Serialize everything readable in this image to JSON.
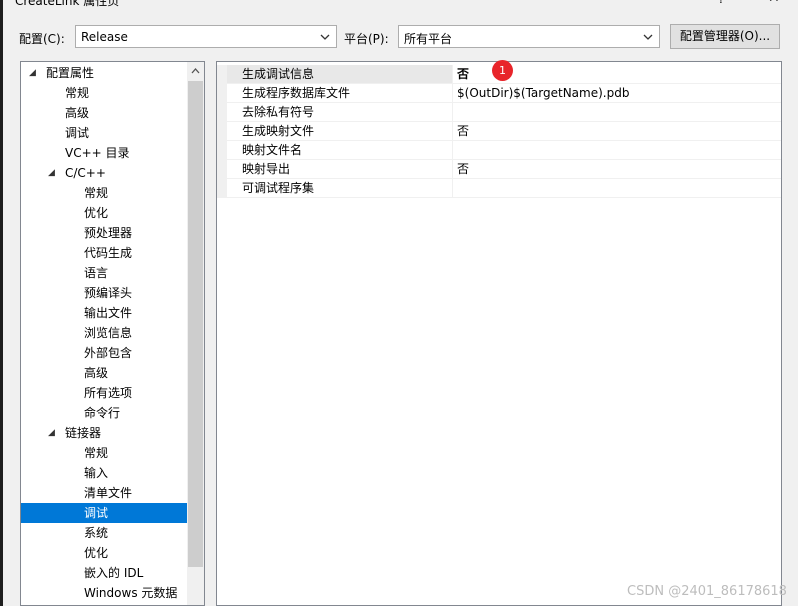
{
  "window": {
    "title": "CreateLink 属性页",
    "help_label": "?",
    "close_label": "✕"
  },
  "config": {
    "config_label": "配置(C):",
    "config_value": "Release",
    "platform_label": "平台(P):",
    "platform_value": "所有平台",
    "manager_button": "配置管理器(O)..."
  },
  "tree": {
    "items": [
      {
        "label": "配置属性",
        "level": 0,
        "expanded": true
      },
      {
        "label": "常规",
        "level": 1
      },
      {
        "label": "高级",
        "level": 1
      },
      {
        "label": "调试",
        "level": 1
      },
      {
        "label": "VC++ 目录",
        "level": 1
      },
      {
        "label": "C/C++",
        "level": 1,
        "expanded": true
      },
      {
        "label": "常规",
        "level": 2
      },
      {
        "label": "优化",
        "level": 2
      },
      {
        "label": "预处理器",
        "level": 2
      },
      {
        "label": "代码生成",
        "level": 2
      },
      {
        "label": "语言",
        "level": 2
      },
      {
        "label": "预编译头",
        "level": 2
      },
      {
        "label": "输出文件",
        "level": 2
      },
      {
        "label": "浏览信息",
        "level": 2
      },
      {
        "label": "外部包含",
        "level": 2
      },
      {
        "label": "高级",
        "level": 2
      },
      {
        "label": "所有选项",
        "level": 2
      },
      {
        "label": "命令行",
        "level": 2
      },
      {
        "label": "链接器",
        "level": 1,
        "expanded": true
      },
      {
        "label": "常规",
        "level": 2
      },
      {
        "label": "输入",
        "level": 2
      },
      {
        "label": "清单文件",
        "level": 2
      },
      {
        "label": "调试",
        "level": 2,
        "selected": true
      },
      {
        "label": "系统",
        "level": 2
      },
      {
        "label": "优化",
        "level": 2
      },
      {
        "label": "嵌入的 IDL",
        "level": 2
      },
      {
        "label": "Windows 元数据",
        "level": 2
      }
    ]
  },
  "grid": {
    "rows": [
      {
        "name": "生成调试信息",
        "value": "否",
        "bold": true
      },
      {
        "name": "生成程序数据库文件",
        "value": "$(OutDir)$(TargetName).pdb"
      },
      {
        "name": "去除私有符号",
        "value": ""
      },
      {
        "name": "生成映射文件",
        "value": "否"
      },
      {
        "name": "映射文件名",
        "value": ""
      },
      {
        "name": "映射导出",
        "value": "否"
      },
      {
        "name": "可调试程序集",
        "value": ""
      }
    ]
  },
  "annotation": {
    "badge": "1"
  },
  "watermark": "CSDN @2401_86178618",
  "colors": {
    "selection": "#0078d7",
    "badge": "#e8242a"
  }
}
